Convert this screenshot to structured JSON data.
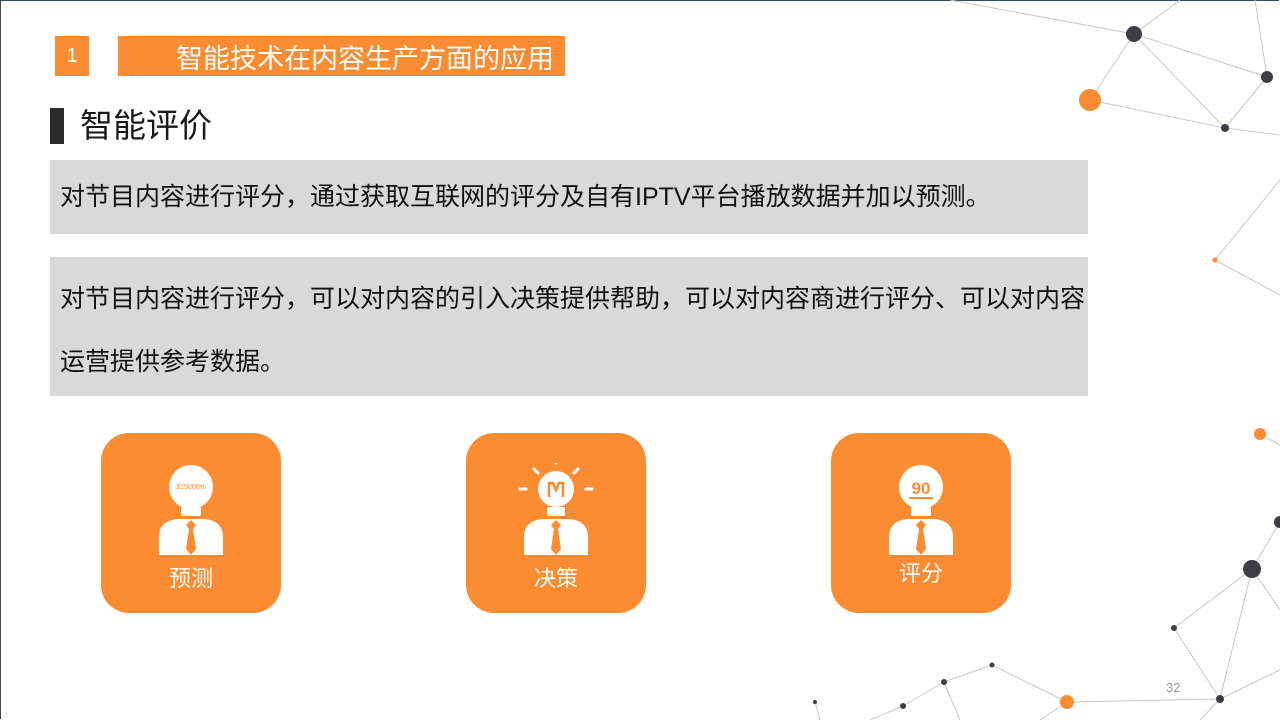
{
  "section": {
    "number": "1",
    "title": "智能技术在内容生产方面的应用"
  },
  "heading": "智能评价",
  "paragraphs": [
    "对节目内容进行评分，通过获取互联网的评分及自有IPTV平台播放数据并加以预测。",
    "对节目内容进行评分，可以对内容的引入决策提供帮助，可以对内容商进行评分、可以对内容运营提供参考数据。"
  ],
  "cards": [
    {
      "label": "预测",
      "icon": "lightbulb-person-forecast-icon",
      "bulb_text": "$15000%"
    },
    {
      "label": "决策",
      "icon": "lightbulb-person-decision-icon"
    },
    {
      "label": "评分",
      "icon": "lightbulb-person-score-icon",
      "bulb_text": "90"
    }
  ],
  "page_number": "32",
  "colors": {
    "accent": "#fb8c32",
    "panel": "#d9d9d9",
    "heading_bar": "#2a2a2a",
    "node_dark": "#3d3d48"
  }
}
